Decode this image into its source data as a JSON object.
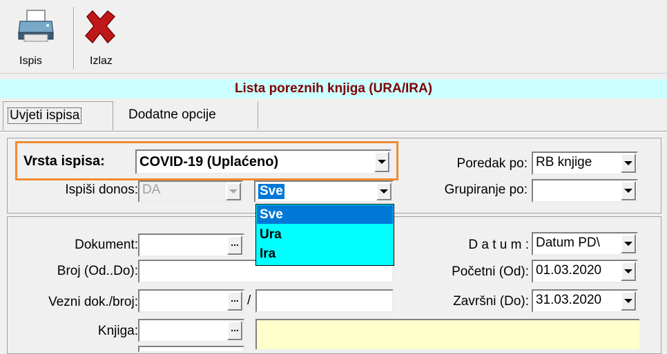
{
  "toolbar": {
    "print_label": "Ispis",
    "exit_label": "Izlaz",
    "print_icon": "printer-icon",
    "exit_icon": "close-x-icon"
  },
  "title": "Lista poreznih knjiga (URA/IRA)",
  "tabs": [
    {
      "label": "Uvjeti ispisa",
      "active": true
    },
    {
      "label": "Dodatne opcije",
      "active": false
    }
  ],
  "form": {
    "vrsta_ispisa_label": "Vrsta ispisa:",
    "vrsta_ispisa_value": "COVID-19 (Uplaćeno)",
    "ispisi_donos_label": "Ispiši donos:",
    "ispisi_donos_value": "DA",
    "filter_value": "Sve",
    "filter_options": [
      "Sve",
      "Ura",
      "Ira"
    ],
    "poredak_label": "Poredak po:",
    "poredak_value": "RB knjige",
    "grupiranje_label": "Grupiranje po:",
    "grupiranje_value": "",
    "dokument_label": "Dokument:",
    "broj_label": "Broj (Od..Do):",
    "vezni_label": "Vezni dok./broj:",
    "vezni_separator": "/",
    "knjiga_label": "Knjiga:",
    "datum_label": "D a t u m :",
    "datum_value": "Datum PD\\",
    "pocetni_label": "Početni (Od):",
    "pocetni_value": "01.03.2020",
    "zavrsni_label": "Završni (Do):",
    "zavrsni_value": "31.03.2020"
  },
  "colors": {
    "title_bar_bg": "#ccffff",
    "title_text": "#800000",
    "dropdown_list_bg": "#00ffff",
    "selection_bg": "#0078d7",
    "highlight_border": "#f08a30",
    "readonly_yellow": "#ffffcc"
  }
}
